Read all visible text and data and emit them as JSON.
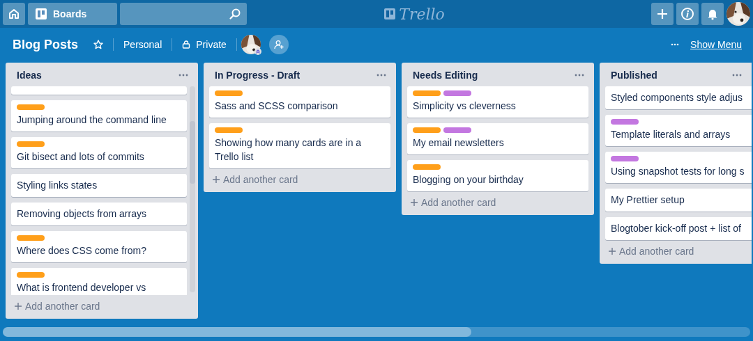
{
  "top_bar": {
    "boards_label": "Boards",
    "logo": "Trello"
  },
  "board": {
    "title": "Blog Posts",
    "team": "Personal",
    "visibility": "Private",
    "show_menu": "Show Menu"
  },
  "lists": [
    {
      "title": "Ideas",
      "scrolled": true,
      "add_label": "Add another card",
      "cards": [
        {
          "kind": "cut"
        },
        {
          "kind": "card",
          "labels": [
            {
              "color": "#ff9f1a"
            }
          ],
          "text": "Jumping around the command line"
        },
        {
          "kind": "card",
          "labels": [
            {
              "color": "#ff9f1a"
            }
          ],
          "text": "Git bisect and lots of commits"
        },
        {
          "kind": "card",
          "text": "Styling links states"
        },
        {
          "kind": "card",
          "text": "Removing objects from arrays"
        },
        {
          "kind": "card",
          "labels": [
            {
              "color": "#ff9f1a"
            }
          ],
          "text": "Where does CSS come from?"
        },
        {
          "kind": "card",
          "labels": [
            {
              "color": "#ff9f1a"
            }
          ],
          "text": "What is frontend developer vs"
        }
      ]
    },
    {
      "title": "In Progress - Draft",
      "scrolled": false,
      "add_label": "Add another card",
      "cards": [
        {
          "kind": "card",
          "labels": [
            {
              "color": "#ff9f1a"
            }
          ],
          "text": "Sass and SCSS comparison"
        },
        {
          "kind": "card",
          "labels": [
            {
              "color": "#ff9f1a"
            }
          ],
          "text": "Showing how many cards are in a Trello list"
        }
      ]
    },
    {
      "title": "Needs Editing",
      "scrolled": false,
      "add_label": "Add another card",
      "cards": [
        {
          "kind": "card",
          "labels": [
            {
              "color": "#ff9f1a"
            },
            {
              "color": "#c377e0"
            }
          ],
          "text": "Simplicity vs cleverness"
        },
        {
          "kind": "card",
          "labels": [
            {
              "color": "#ff9f1a"
            },
            {
              "color": "#c377e0"
            }
          ],
          "text": "My email newsletters"
        },
        {
          "kind": "card",
          "labels": [
            {
              "color": "#ff9f1a"
            }
          ],
          "text": "Blogging on your birthday"
        }
      ]
    },
    {
      "title": "Published",
      "scrolled": false,
      "add_label": "Add another card",
      "cards": [
        {
          "kind": "card",
          "text": "Styled components style adjus"
        },
        {
          "kind": "card",
          "labels": [
            {
              "color": "#c377e0"
            }
          ],
          "text": "Template literals and arrays"
        },
        {
          "kind": "card",
          "labels": [
            {
              "color": "#c377e0"
            }
          ],
          "text": "Using snapshot tests for long s"
        },
        {
          "kind": "card",
          "text": "My Prettier setup"
        },
        {
          "kind": "card",
          "text": "Blogtober kick-off post + list of"
        }
      ]
    }
  ]
}
